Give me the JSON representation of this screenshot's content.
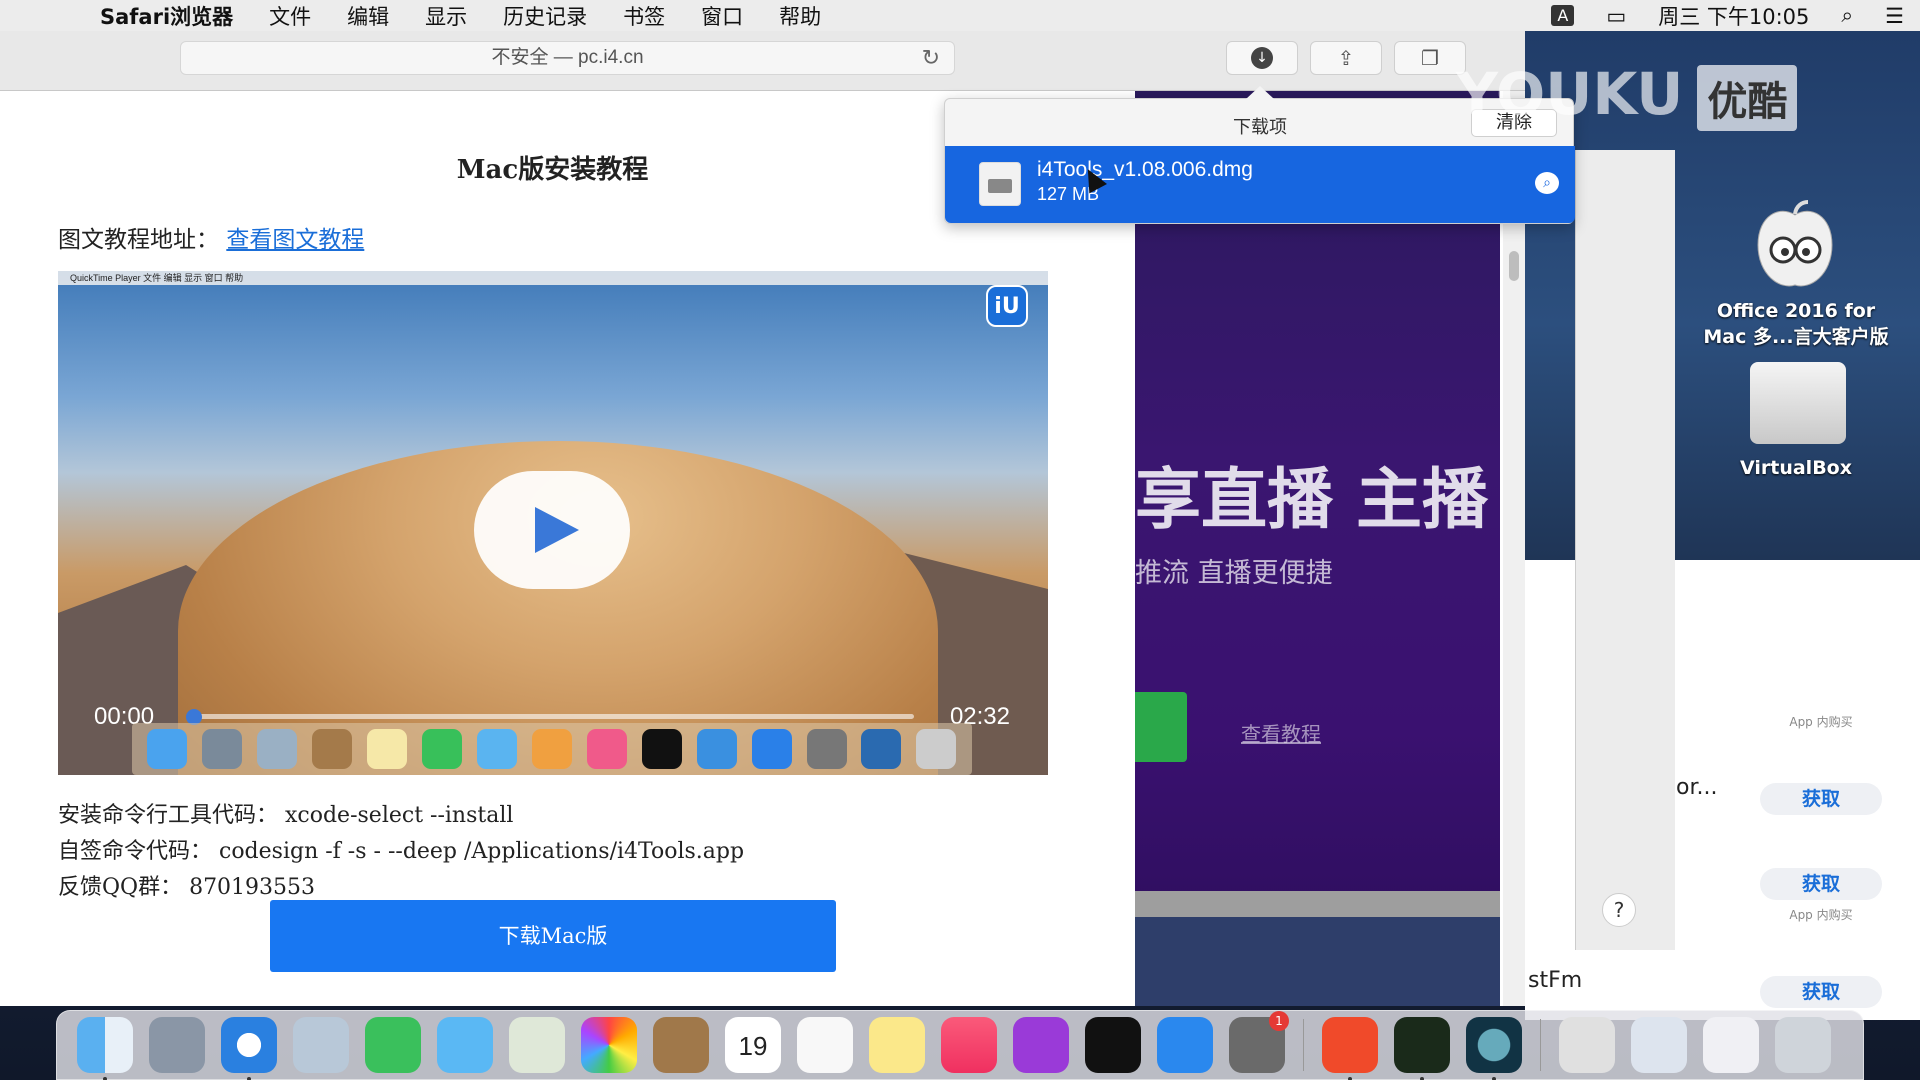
{
  "menubar": {
    "app_name": "Safari浏览器",
    "items": [
      "文件",
      "编辑",
      "显示",
      "历史记录",
      "书签",
      "窗口",
      "帮助"
    ],
    "input_badge": "A",
    "clock": "周三 下午10:05"
  },
  "safari": {
    "address": "不安全 — pc.i4.cn"
  },
  "page": {
    "title": "Mac版安装教程",
    "tutorial_label": "图文教程地址：",
    "tutorial_link": "查看图文教程",
    "video": {
      "menubar_text": "QuickTime Player   文件   编辑   显示   窗口   帮助",
      "time_start": "00:00",
      "time_end": "02:32",
      "progress": 0
    },
    "install_cmd": "安装命令行工具代码：  xcode-select --install",
    "sign_cmd": "自签命令代码：  codesign -f -s - --deep /Applications/i4Tools.app",
    "qq_group": "反馈QQ群：  870193553",
    "download_button": "下载Mac版"
  },
  "side_page": {
    "live_title": "享直播  主播",
    "live_subtitle": "推流  直播更便捷",
    "view_tutorial": "查看教程"
  },
  "downloads": {
    "header": "下载项",
    "clear_label": "清除",
    "items": [
      {
        "name": "i4Tools_v1.08.006.dmg",
        "size": "127 MB"
      }
    ]
  },
  "appstore": {
    "get_label": "获取",
    "inapp_label": "App 内购买",
    "or_text": "or...",
    "stfm_text": "stFm",
    "help": "?"
  },
  "desktop": {
    "office_label_line1": "Office 2016 for",
    "office_label_line2": "Mac 多...言大客户版",
    "vbox_label": "VirtualBox"
  },
  "watermark": {
    "text": "YOUKU",
    "box": "优酷"
  },
  "dock": {
    "calendar_day": "19",
    "notification_count": "1"
  },
  "colors": {
    "accent": "#1877f2",
    "selection": "#1766e0",
    "purple": "#3a1670"
  }
}
